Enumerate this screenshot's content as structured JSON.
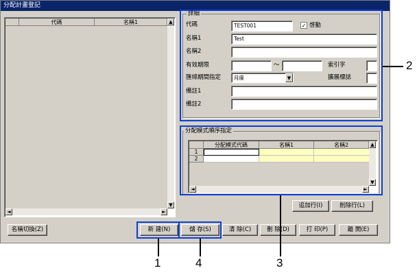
{
  "window": {
    "title": "分配計畫登記"
  },
  "left_list": {
    "columns": [
      "代碼",
      "名稱1"
    ],
    "scroll_up": "▲",
    "scroll_down": "▼",
    "scroll_left": "◄",
    "scroll_right": "►"
  },
  "details": {
    "group_label": "詳細",
    "code_label": "代碼",
    "code_value": "TEST001",
    "enabled_label": "啓動",
    "enabled_checked": true,
    "name1_label": "名稱1",
    "name1_value": "Test",
    "name2_label": "名稱2",
    "name2_value": "",
    "valid_period_label": "有效期限",
    "valid_from": "",
    "valid_to": "",
    "range_sep": "～",
    "index_label": "索引字",
    "index_value": "",
    "period_label": "匯總期間指定",
    "period_value": "月度",
    "expand_flag_label": "擴展標誌",
    "expand_flag_value": "",
    "note1_label": "備註1",
    "note1_value": "",
    "note2_label": "備註2",
    "note2_value": ""
  },
  "pattern": {
    "group_label": "分配模式順序指定",
    "columns": [
      "分配模式代碼",
      "名稱1",
      "名稱2"
    ],
    "rows": [
      {
        "num": "1",
        "code": "",
        "name1": "",
        "name2": ""
      },
      {
        "num": "2",
        "code": "",
        "name1": "",
        "name2": ""
      }
    ],
    "add_row": "追加行(I)",
    "delete_row": "削除行(L)"
  },
  "buttons": {
    "name_switch": "名稱切換(Z)",
    "new": "新  建(N)",
    "save": "儲  存(S)",
    "clear": "清  除(C)",
    "delete": "刪  除(D)",
    "print": "打  印(P)",
    "close": "離  開(E)"
  },
  "callouts": {
    "one": "1",
    "two": "2",
    "three": "3",
    "four": "4"
  },
  "colors": {
    "title_bar": "#0a246a",
    "highlight": "#0a3fd6",
    "grid_yellow": "#ffffc0"
  }
}
